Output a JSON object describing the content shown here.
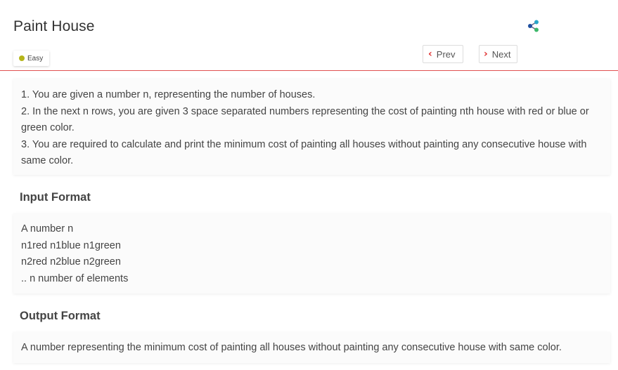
{
  "problem": {
    "title": "Paint House",
    "difficulty": "Easy",
    "difficulty_color": "#b5b51a"
  },
  "nav": {
    "prev_label": "Prev",
    "next_label": "Next"
  },
  "accent_color": "#e03030",
  "description": {
    "lines": [
      "1. You are given a number n, representing the number of houses.",
      "2. In the next n rows, you are given 3 space separated numbers representing the cost of painting nth house with red or blue or green color.",
      "3. You are required to calculate and print the minimum cost of painting all houses without painting any consecutive house with same color."
    ]
  },
  "input_format": {
    "heading": "Input Format",
    "lines": [
      "A number n",
      "n1red n1blue n1green",
      "n2red n2blue n2green",
      ".. n number of elements"
    ]
  },
  "output_format": {
    "heading": "Output Format",
    "lines": [
      "A number representing the minimum cost of painting all houses without painting any consecutive house with same color."
    ]
  },
  "icons": {
    "share": "share-icon",
    "prev": "chevron-left-icon",
    "next": "chevron-right-icon"
  }
}
